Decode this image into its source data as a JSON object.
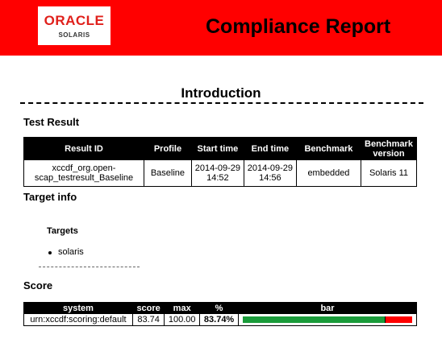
{
  "header": {
    "logo_brand": "ORACLE",
    "logo_product": "SOLARIS",
    "title": "Compliance Report",
    "background_color": "#ff0000"
  },
  "introduction": {
    "title": "Introduction"
  },
  "test_result": {
    "heading": "Test Result",
    "columns": [
      "Result ID",
      "Profile",
      "Start time",
      "End time",
      "Benchmark",
      "Benchmark version"
    ],
    "row": {
      "result_id": "xccdf_org.open-scap_testresult_Baseline",
      "profile": "Baseline",
      "start_time": "2014-09-29 14:52",
      "end_time": "2014-09-29 14:56",
      "benchmark": "embedded",
      "benchmark_version": "Solaris 11"
    }
  },
  "target_info": {
    "heading": "Target info",
    "targets_label": "Targets",
    "targets": [
      "solaris"
    ]
  },
  "score": {
    "heading": "Score",
    "columns": [
      "system",
      "score",
      "max",
      "%",
      "bar"
    ],
    "row": {
      "system": "urn:xccdf:scoring:default",
      "score": "83.74",
      "max": "100.00",
      "percent": "83.74%",
      "bar_fraction": 0.8374,
      "bar_pass_color": "#1a9b3a",
      "bar_fail_color": "#ff0000"
    }
  }
}
